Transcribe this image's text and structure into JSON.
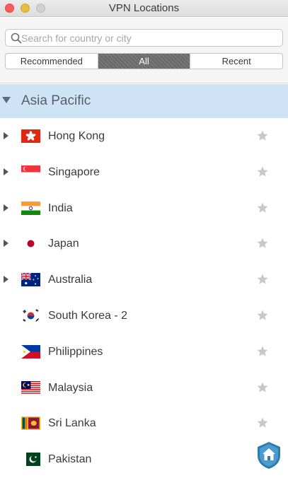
{
  "window": {
    "title": "VPN Locations"
  },
  "search": {
    "placeholder": "Search for country or city"
  },
  "tabs": [
    {
      "label": "Recommended",
      "active": false
    },
    {
      "label": "All",
      "active": true
    },
    {
      "label": "Recent",
      "active": false
    }
  ],
  "section": {
    "label": "Asia Pacific",
    "expanded": true
  },
  "locations": [
    {
      "name": "Hong Kong",
      "expandable": true,
      "flag": "hong-kong-flag",
      "favorite": false
    },
    {
      "name": "Singapore",
      "expandable": true,
      "flag": "singapore-flag",
      "favorite": false
    },
    {
      "name": "India",
      "expandable": true,
      "flag": "india-flag",
      "favorite": false
    },
    {
      "name": "Japan",
      "expandable": true,
      "flag": "japan-flag",
      "favorite": false
    },
    {
      "name": "Australia",
      "expandable": true,
      "flag": "australia-flag",
      "favorite": false
    },
    {
      "name": "South Korea - 2",
      "expandable": false,
      "flag": "south-korea-flag",
      "favorite": false
    },
    {
      "name": "Philippines",
      "expandable": false,
      "flag": "philippines-flag",
      "favorite": false
    },
    {
      "name": "Malaysia",
      "expandable": false,
      "flag": "malaysia-flag",
      "favorite": false
    },
    {
      "name": "Sri Lanka",
      "expandable": false,
      "flag": "sri-lanka-flag",
      "favorite": false
    },
    {
      "name": "Pakistan",
      "expandable": false,
      "flag": "pakistan-flag",
      "favorite": false
    }
  ],
  "colors": {
    "section_bg": "#cfe3f7",
    "active_tab": "#6f6f6f",
    "star": "#c8c8c8",
    "badge": "#2e7bb0"
  }
}
